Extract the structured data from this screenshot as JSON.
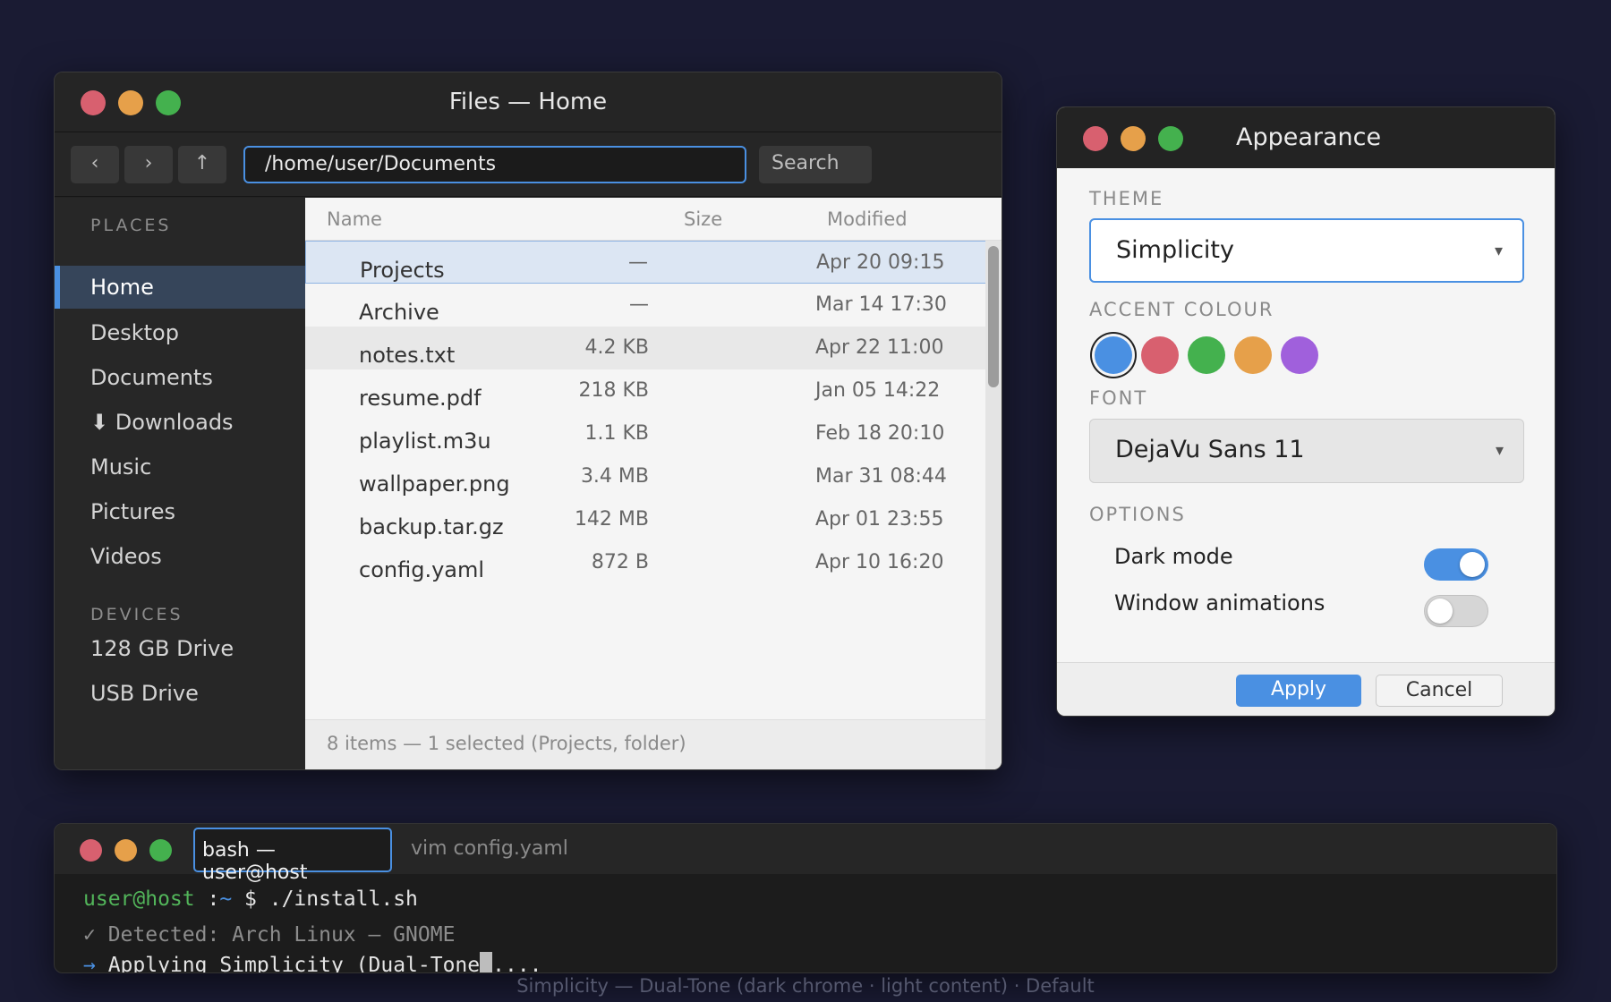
{
  "files": {
    "title": "Files — Home",
    "nav": {
      "back": "‹",
      "forward": "›",
      "up": "↑"
    },
    "path": "/home/user/Documents",
    "search_label": "Search",
    "places_heading": "PLACES",
    "devices_heading": "DEVICES",
    "places": [
      {
        "icon": "",
        "label": "Home",
        "active": true
      },
      {
        "icon": "",
        "label": "Desktop"
      },
      {
        "icon": "",
        "label": "Documents"
      },
      {
        "icon": "⬇",
        "label": "Downloads"
      },
      {
        "icon": "",
        "label": "Music"
      },
      {
        "icon": "",
        "label": "Pictures"
      },
      {
        "icon": "",
        "label": "Videos"
      }
    ],
    "devices": [
      {
        "icon": "",
        "label": "128 GB Drive"
      },
      {
        "icon": "",
        "label": "USB Drive"
      }
    ],
    "columns": {
      "name": "Name",
      "size": "Size",
      "modified": "Modified"
    },
    "rows": [
      {
        "icon": "",
        "name": "Projects",
        "size": "—",
        "modified": "Apr 20 09:15"
      },
      {
        "icon": "",
        "name": "Archive",
        "size": "—",
        "modified": "Mar 14 17:30"
      },
      {
        "icon": "",
        "name": "notes.txt",
        "size": "4.2 KB",
        "modified": "Apr 22 11:00"
      },
      {
        "icon": "",
        "name": "resume.pdf",
        "size": "218 KB",
        "modified": "Jan 05 14:22"
      },
      {
        "icon": "",
        "name": "playlist.m3u",
        "size": "1.1 KB",
        "modified": "Feb 18 20:10"
      },
      {
        "icon": "",
        "name": "wallpaper.png",
        "size": "3.4 MB",
        "modified": "Mar 31 08:44"
      },
      {
        "icon": "",
        "name": "backup.tar.gz",
        "size": "142 MB",
        "modified": "Apr 01 23:55"
      },
      {
        "icon": "",
        "name": "config.yaml",
        "size": "872 B",
        "modified": "Apr 10 16:20"
      }
    ],
    "status": "8 items — 1 selected (Projects, folder)"
  },
  "appearance": {
    "title": "Appearance",
    "theme_label": "THEME",
    "theme_value": "Simplicity",
    "accent_label": "ACCENT COLOUR",
    "accent_colors": [
      "#4a90e2",
      "#d8606f",
      "#44b14e",
      "#e6a04a",
      "#a060dc"
    ],
    "font_label": "FONT",
    "font_value": "DejaVu Sans 11",
    "options_label": "OPTIONS",
    "options": [
      {
        "label": "Dark mode",
        "on": true
      },
      {
        "label": "Window animations",
        "on": false
      }
    ],
    "apply": "Apply",
    "cancel": "Cancel",
    "caret": "▾"
  },
  "terminal": {
    "tabs": [
      "bash — user@host",
      "vim config.yaml"
    ],
    "prompt_user": "user@host",
    "prompt_sep": " :",
    "prompt_path": "~",
    "prompt_cmd": " $ ./install.sh",
    "line2": "✓ Detected: Arch Linux — GNOME",
    "line3_arrow": "→",
    "line3_before": " Applying Simplicity (Dual-Tone",
    "line3_after": "...."
  },
  "caption": "Simplicity — Dual-Tone (dark chrome · light content) · Default"
}
